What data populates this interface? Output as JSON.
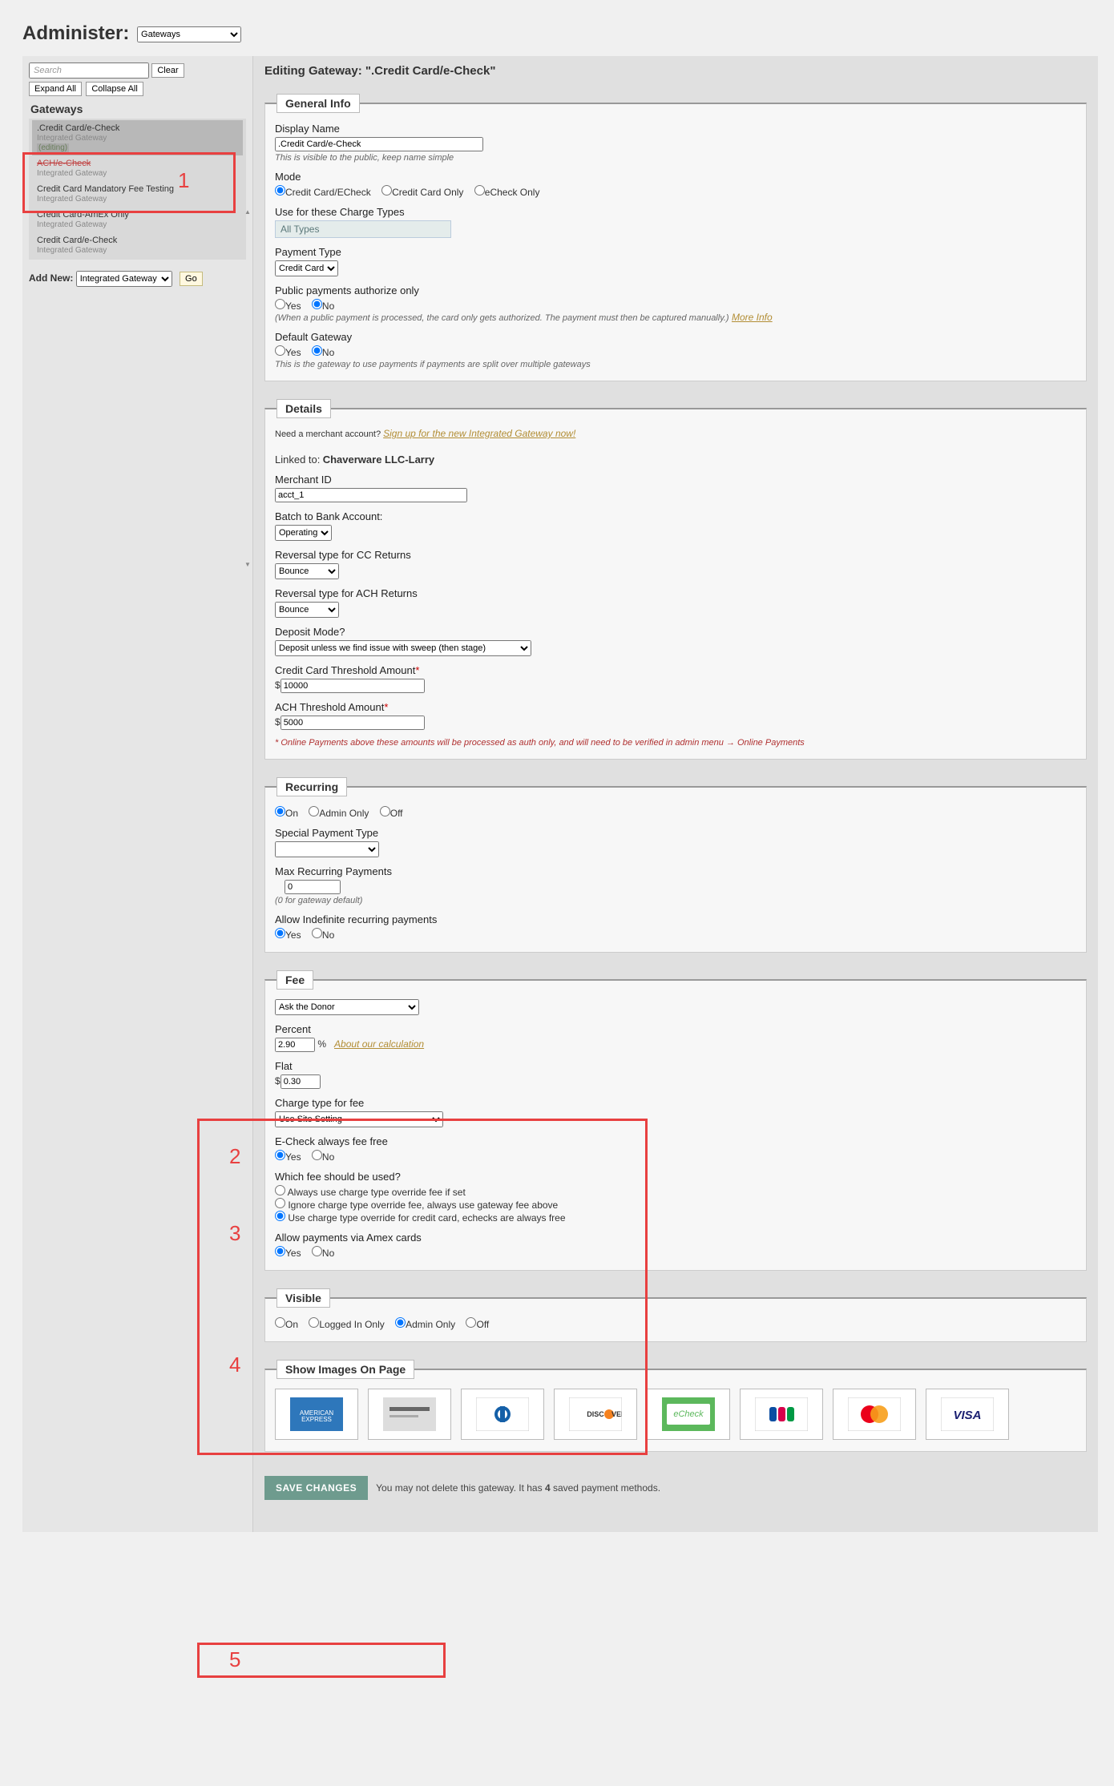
{
  "header": {
    "title_prefix": "Administer:",
    "select_value": "Gateways",
    "search_placeholder": "Search",
    "clear": "Clear",
    "expand": "Expand All",
    "collapse": "Collapse All"
  },
  "sidebar": {
    "heading": "Gateways",
    "items": [
      {
        "name": ".Credit Card/e-Check",
        "sub": "Integrated Gateway",
        "editing": "(editing)"
      },
      {
        "name": "ACH/e-Check",
        "sub": "Integrated Gateway"
      },
      {
        "name": "Credit Card Mandatory Fee Testing",
        "sub": "Integrated Gateway"
      },
      {
        "name": "Credit Card-AmEx Only",
        "sub": "Integrated Gateway"
      },
      {
        "name": "Credit Card/e-Check",
        "sub": "Integrated Gateway"
      }
    ],
    "addnew_label": "Add New:",
    "addnew_select": "Integrated Gateway",
    "go": "Go"
  },
  "content": {
    "heading": "Editing Gateway: \".Credit Card/e-Check\""
  },
  "general": {
    "legend": "General Info",
    "display_label": "Display Name",
    "display_value": ".Credit Card/e-Check",
    "display_help": "This is visible to the public, keep name simple",
    "mode_label": "Mode",
    "mode_opt1": "Credit Card/ECheck",
    "mode_opt2": "Credit Card Only",
    "mode_opt3": "eCheck Only",
    "charge_label": "Use for these Charge Types",
    "charge_value": "All Types",
    "payment_label": "Payment Type",
    "payment_value": "Credit Card",
    "pub_label": "Public payments authorize only",
    "yes": "Yes",
    "no": "No",
    "pub_help": "(When a public payment is processed, the card only gets authorized. The payment must then be captured manually.)",
    "more": "More Info",
    "default_label": "Default Gateway",
    "default_help": "This is the gateway to use payments if payments are split over multiple gateways"
  },
  "details": {
    "legend": "Details",
    "merchant_need": "Need a merchant account? ",
    "merchant_link": "Sign up for the new Integrated Gateway now!",
    "linked_label": "Linked to:",
    "linked_value": "Chaverware LLC-Larry",
    "mid_label": "Merchant ID",
    "mid_value": "acct_1",
    "batch_label": "Batch to Bank Account:",
    "batch_value": "Operating",
    "revcc_label": "Reversal type for CC Returns",
    "revcc_value": "Bounce",
    "revach_label": "Reversal type for ACH Returns",
    "revach_value": "Bounce",
    "dep_label": "Deposit Mode?",
    "dep_value": "Deposit unless we find issue with sweep (then stage)",
    "cc_thresh_label": "Credit Card Threshold Amount",
    "cc_thresh_value": "10000",
    "ach_thresh_label": "ACH Threshold Amount",
    "ach_thresh_value": "5000",
    "thresh_help": "* Online Payments above these amounts will be processed as auth only, and will need to be verified in admin menu → Online Payments"
  },
  "recurring": {
    "legend": "Recurring",
    "on": "On",
    "admin": "Admin Only",
    "off": "Off",
    "sp_label": "Special Payment Type",
    "sp_value": "",
    "max_label": "Max Recurring Payments",
    "max_value": "0",
    "max_help": "(0 for gateway default)",
    "indef_label": "Allow Indefinite recurring payments",
    "yes": "Yes",
    "no": "No"
  },
  "fee": {
    "legend": "Fee",
    "mode_value": "Ask the Donor",
    "pct_label": "Percent",
    "pct_value": "2.90",
    "pct_suffix": "%",
    "pct_link": "About our calculation",
    "flat_label": "Flat",
    "flat_value": "0.30",
    "ct_label": "Charge type for fee",
    "ct_value": "Use Site Setting",
    "ech_label": "E-Check always fee free",
    "yes": "Yes",
    "no": "No",
    "which_label": "Which fee should be used?",
    "which_o1": "Always use charge type override fee if set",
    "which_o2": "Ignore charge type override fee, always use gateway fee above",
    "which_o3": "Use charge type override for credit card, echecks are always free",
    "amex_label": "Allow payments via Amex cards"
  },
  "visible": {
    "legend": "Visible",
    "on": "On",
    "logged": "Logged In Only",
    "admin": "Admin Only",
    "off": "Off"
  },
  "images": {
    "legend": "Show Images On Page"
  },
  "bottom": {
    "save": "SAVE CHANGES",
    "note_p1": "You may not delete this gateway. It has ",
    "note_count": "4",
    "note_p2": " saved payment methods."
  },
  "annotate": {
    "n1": "1",
    "n2": "2",
    "n3": "3",
    "n4": "4",
    "n5": "5"
  }
}
